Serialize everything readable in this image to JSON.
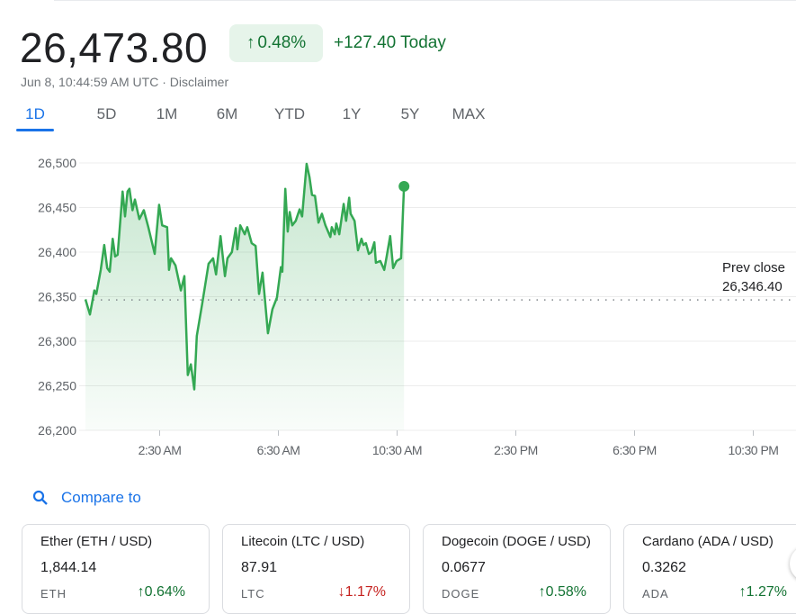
{
  "header": {
    "price": "26,473.80",
    "change_pct": "0.48%",
    "change_abs": "+127.40 Today",
    "timestamp": "Jun 8, 10:44:59 AM UTC",
    "separator": "·",
    "disclaimer": "Disclaimer",
    "up_arrow": "↑"
  },
  "range_tabs": [
    {
      "label": "1D",
      "active": true
    },
    {
      "label": "5D"
    },
    {
      "label": "1M"
    },
    {
      "label": "6M"
    },
    {
      "label": "YTD"
    },
    {
      "label": "1Y"
    },
    {
      "label": "5Y"
    },
    {
      "label": "MAX"
    }
  ],
  "colors": {
    "up": "#137333",
    "line": "#34a853",
    "down": "#c5221f",
    "accent": "#1a73e8"
  },
  "chart_data": {
    "type": "line",
    "xlim": [
      "00:00",
      "24:00"
    ],
    "ylim": [
      26200,
      26500
    ],
    "y_ticks": [
      26500,
      26450,
      26400,
      26350,
      26300,
      26250,
      26200
    ],
    "y_tick_labels": [
      "26,500",
      "26,450",
      "26,400",
      "26,350",
      "26,300",
      "26,250",
      "26,200"
    ],
    "x_ticks": [
      "02:30",
      "06:30",
      "10:30",
      "14:30",
      "18:30",
      "22:30"
    ],
    "x_tick_labels": [
      "2:30 AM",
      "6:30 AM",
      "10:30 AM",
      "2:30 PM",
      "6:30 PM",
      "10:30 PM"
    ],
    "grid": true,
    "prev_close": {
      "label": "Prev close",
      "value": 26346.4,
      "value_label": "26,346.40"
    },
    "series": [
      {
        "x": [
          "00:00",
          "00:09",
          "00:18",
          "00:22",
          "00:31",
          "00:38",
          "00:44",
          "00:49",
          "00:55",
          "01:00",
          "01:05",
          "01:15",
          "01:20",
          "01:25",
          "01:29",
          "01:35",
          "01:40",
          "01:49",
          "01:58",
          "02:07",
          "02:20",
          "02:29",
          "02:35",
          "02:45",
          "02:49",
          "02:53",
          "03:02",
          "03:13",
          "03:20",
          "03:27",
          "03:33",
          "03:40",
          "03:45",
          "03:56",
          "04:09",
          "04:18",
          "04:24",
          "04:33",
          "04:42",
          "04:47",
          "04:56",
          "05:04",
          "05:07",
          "05:13",
          "05:22",
          "05:27",
          "05:36",
          "05:44",
          "05:51",
          "05:58",
          "06:09",
          "06:18",
          "06:27",
          "06:35",
          "06:38",
          "06:44",
          "06:49",
          "06:53",
          "06:58",
          "07:05",
          "07:13",
          "07:18",
          "07:27",
          "07:33",
          "07:38",
          "07:44",
          "07:51",
          "07:58",
          "08:05",
          "08:15",
          "08:18",
          "08:24",
          "08:27",
          "08:33",
          "08:42",
          "08:47",
          "08:53",
          "08:56",
          "09:04",
          "09:11",
          "09:18",
          "09:22",
          "09:27",
          "09:33",
          "09:38",
          "09:44",
          "09:47",
          "09:56",
          "10:04",
          "10:09",
          "10:16",
          "10:22",
          "10:29",
          "10:38",
          "10:44"
        ],
        "y": [
          26347,
          26330,
          26357,
          26353,
          26380,
          26408,
          26382,
          26378,
          26415,
          26395,
          26397,
          26468,
          26440,
          26468,
          26471,
          26447,
          26459,
          26437,
          26447,
          26428,
          26398,
          26453,
          26430,
          26428,
          26380,
          26393,
          26385,
          26357,
          26373,
          26262,
          26274,
          26246,
          26306,
          26342,
          26387,
          26393,
          26375,
          26418,
          26373,
          26393,
          26400,
          26427,
          26403,
          26430,
          26420,
          26428,
          26410,
          26407,
          26353,
          26377,
          26309,
          26336,
          26349,
          26383,
          26378,
          26471,
          26423,
          26445,
          26430,
          26435,
          26448,
          26440,
          26499,
          26484,
          26464,
          26463,
          26433,
          26443,
          26430,
          26417,
          26428,
          26420,
          26432,
          26420,
          26454,
          26435,
          26461,
          26443,
          26435,
          26402,
          26415,
          26408,
          26410,
          26398,
          26400,
          26411,
          26388,
          26390,
          26380,
          26395,
          26418,
          26382,
          26390,
          26393,
          26473.8
        ]
      }
    ]
  },
  "compare": {
    "label": "Compare to",
    "icon": "search-icon"
  },
  "cards": [
    {
      "name": "Ether (ETH / USD)",
      "value": "1,844.14",
      "symbol": "ETH",
      "arrow": "↑",
      "change": "0.64%",
      "direction": "up"
    },
    {
      "name": "Litecoin (LTC / USD)",
      "value": "87.91",
      "symbol": "LTC",
      "arrow": "↓",
      "change": "1.17%",
      "direction": "down"
    },
    {
      "name": "Dogecoin (DOGE / USD)",
      "value": "0.0677",
      "symbol": "DOGE",
      "arrow": "↑",
      "change": "0.58%",
      "direction": "up"
    },
    {
      "name": "Cardano (ADA / USD)",
      "value": "0.3262",
      "symbol": "ADA",
      "arrow": "↑",
      "change": "1.27%",
      "direction": "up"
    }
  ]
}
